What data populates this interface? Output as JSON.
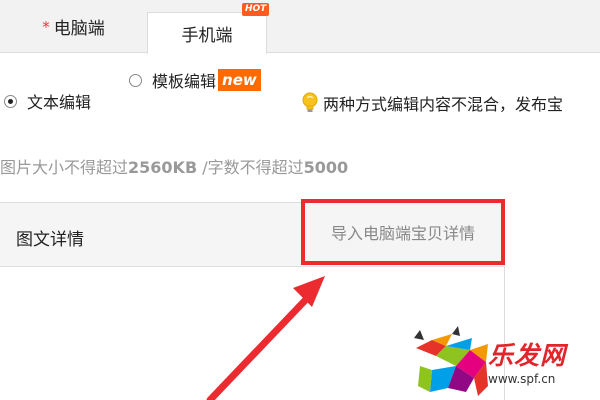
{
  "tabs": {
    "pc": {
      "required_mark": "*",
      "label": "电脑端"
    },
    "mobile": {
      "label": "手机端",
      "badge": "HOT"
    }
  },
  "editor_mode": {
    "text_edit": {
      "label": "文本编辑",
      "checked": true
    },
    "template_edit": {
      "label": "模板编辑",
      "badge": "new",
      "checked": false
    }
  },
  "hint": {
    "text": "两种方式编辑内容不混合，发布宝",
    "icon": "lightbulb-icon"
  },
  "limits": {
    "prefix": "图片大小不得超过",
    "image_max": "2560KB",
    "separator": " /字数不得超过",
    "char_max": "5000"
  },
  "detail_panel": {
    "title": "图文详情",
    "import_link": "导入电脑端宝贝详情"
  },
  "watermark": {
    "brand": "乐发网",
    "url": "www.spf.cn",
    "icon": "bull-logo-icon"
  },
  "colors": {
    "accent_red": "#ec2b30",
    "hot_orange": "#ff5a1f",
    "new_orange": "#ff6a00",
    "muted_text": "#999999"
  }
}
